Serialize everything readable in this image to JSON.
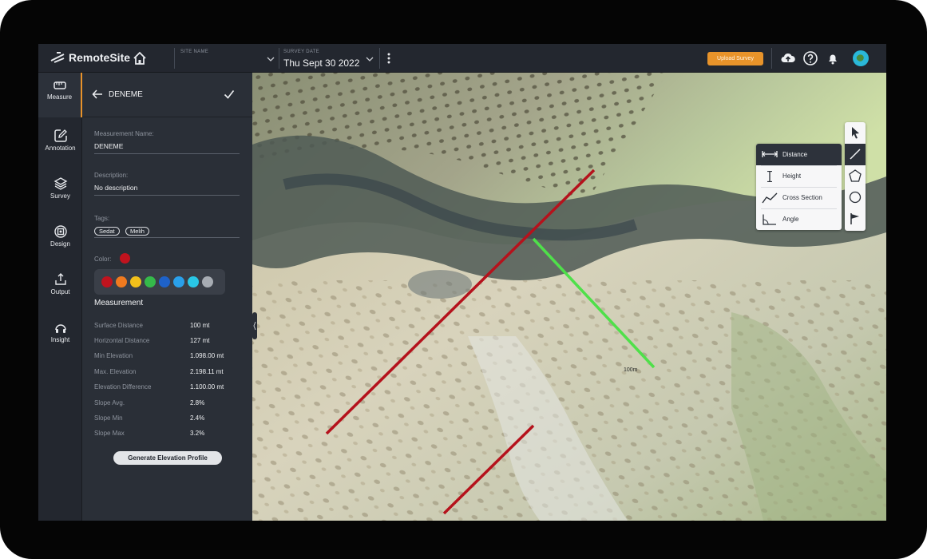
{
  "app": {
    "name": "RemoteSite"
  },
  "topbar": {
    "site_label": "SITE NAME",
    "site_value": "",
    "survey_label": "SURVEY DATE",
    "survey_value": "Thu Sept 30 2022",
    "upload_label": "Upload Survey"
  },
  "nav": {
    "items": [
      {
        "label": "Measure",
        "icon": "ruler-icon"
      },
      {
        "label": "Annotation",
        "icon": "edit-icon"
      },
      {
        "label": "Survey",
        "icon": "layers-icon"
      },
      {
        "label": "Design",
        "icon": "design-icon"
      },
      {
        "label": "Output",
        "icon": "export-icon"
      },
      {
        "label": "Insight",
        "icon": "insight-icon"
      }
    ],
    "active": "Measure"
  },
  "panel": {
    "title": "DENEME",
    "name_label": "Measurement Name:",
    "name_value": "DENEME",
    "desc_label": "Description:",
    "desc_value": "No description",
    "tags_label": "Tags:",
    "tags": [
      "Sedat",
      "Melih"
    ],
    "color_label": "Color:",
    "selected_color": "#c0131e",
    "palette": [
      "#c0131e",
      "#f07a1f",
      "#f2c01b",
      "#35b94a",
      "#1e62c9",
      "#2aa0ea",
      "#29c7e6",
      "#a7acb3"
    ],
    "section_title": "Measurement",
    "measurements": [
      {
        "label": "Surface Distance",
        "value": "100 mt"
      },
      {
        "label": "Horizontal Distance",
        "value": "127 mt"
      },
      {
        "label": "Min Elevation",
        "value": "1.098.00 mt"
      },
      {
        "label": "Max. Elevation",
        "value": "2.198.11 mt"
      },
      {
        "label": "Elevation Difference",
        "value": "1.100.00 mt"
      },
      {
        "label": "Slope Avg.",
        "value": "2.8%"
      },
      {
        "label": "Slope Min",
        "value": "2.4%"
      },
      {
        "label": "Slope Max",
        "value": "3.2%"
      }
    ],
    "generate_label": "Generate Elevation Profile"
  },
  "map": {
    "distance_label": "100m",
    "line_colors": {
      "red": "#b5121c",
      "green": "#4fe04a"
    }
  },
  "tools": {
    "menu": [
      {
        "label": "Distance",
        "icon": "distance-icon"
      },
      {
        "label": "Height",
        "icon": "height-icon"
      },
      {
        "label": "Cross Section",
        "icon": "cross-section-icon"
      },
      {
        "label": "Angle",
        "icon": "angle-icon"
      }
    ],
    "active_menu": "Distance",
    "rail": [
      "pointer-icon",
      "line-icon",
      "polygon-icon",
      "circle-icon",
      "flag-icon"
    ],
    "active_rail": "line-icon"
  },
  "colors": {
    "accent": "#e8932a",
    "panel": "#2a2f37",
    "nav": "#23272f"
  }
}
